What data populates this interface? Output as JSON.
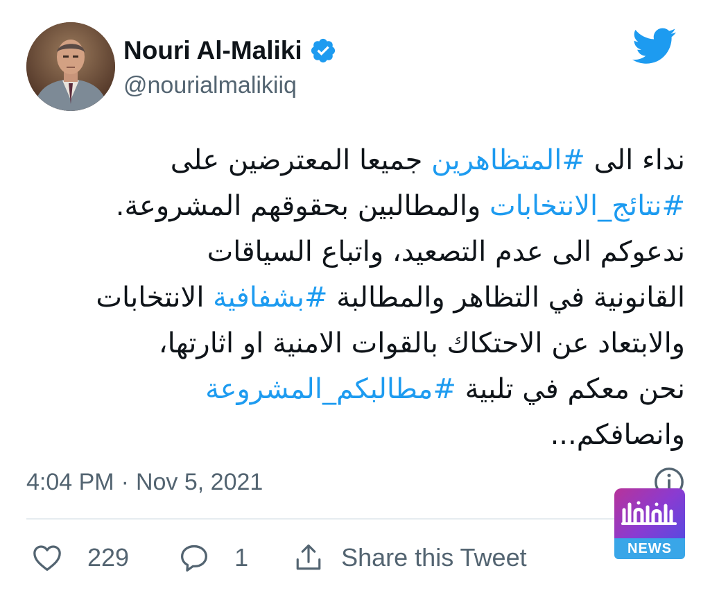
{
  "author": {
    "display_name": "Nouri Al-Maliki",
    "handle": "@nourialmalikiiq",
    "verified": true
  },
  "tweet": {
    "lines": [
      [
        {
          "text": "نداء الى ",
          "hashtag": false
        },
        {
          "text": "#المتظاهرين",
          "hashtag": true
        },
        {
          "text": " جميعا المعترضين على",
          "hashtag": false
        }
      ],
      [
        {
          "text": "#نتائج_الانتخابات",
          "hashtag": true
        },
        {
          "text": " والمطالبين بحقوقهم المشروعة.",
          "hashtag": false
        }
      ],
      [
        {
          "text": "ندعوكم الى عدم التصعيد، واتباع السياقات",
          "hashtag": false
        }
      ],
      [
        {
          "text": "القانونية في التظاهر والمطالبة ",
          "hashtag": false
        },
        {
          "text": "#بشفافية",
          "hashtag": true
        },
        {
          "text": " الانتخابات",
          "hashtag": false
        }
      ],
      [
        {
          "text": "والابتعاد عن الاحتكاك بالقوات الامنية او اثارتها،",
          "hashtag": false
        }
      ],
      [
        {
          "text": "نحن معكم في تلبية ",
          "hashtag": false
        },
        {
          "text": "#مطالبكم_المشروعة",
          "hashtag": true
        }
      ],
      [
        {
          "text": "وانصافكم...",
          "hashtag": false
        }
      ]
    ],
    "time": "4:04 PM",
    "separator": "·",
    "date": "Nov 5, 2021"
  },
  "actions": {
    "like_count": "229",
    "reply_count": "1",
    "share_label": "Share this Tweet"
  },
  "watermark": {
    "arabic_text": "العراق نيوز",
    "label": "NEWS"
  },
  "icons": {
    "verified": "verified-badge-icon",
    "brand": "twitter-bird-icon",
    "info": "info-icon",
    "like": "heart-icon",
    "reply": "reply-bubble-icon",
    "share": "share-icon"
  },
  "colors": {
    "accent": "#1d9bf0",
    "text": "#0f1419",
    "secondary": "#536471",
    "divider": "#e6ecf0"
  }
}
